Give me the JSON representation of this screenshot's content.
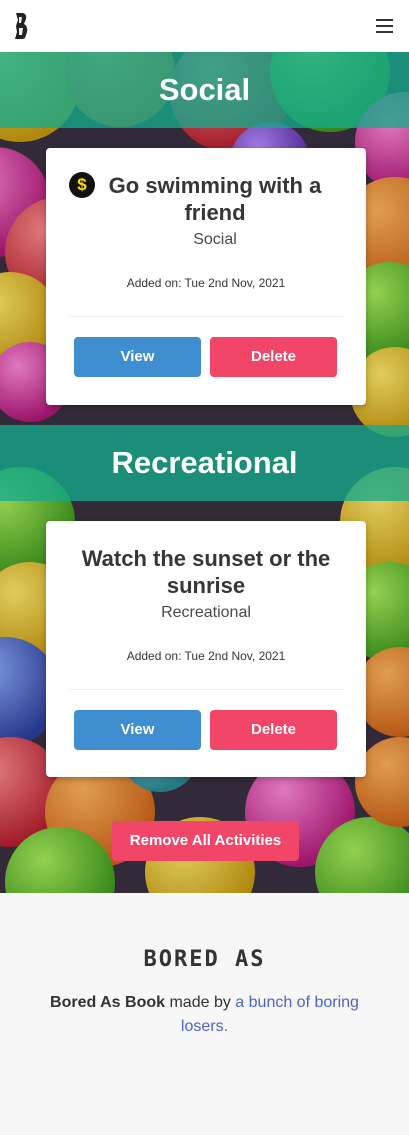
{
  "nav": {
    "logo_icon": "brand-logo-icon",
    "menu_icon": "hamburger-menu-icon"
  },
  "sections": [
    {
      "heading": "Social",
      "card": {
        "icon": "dollar-coin-icon",
        "title": "Go swimming with a friend",
        "type": "Social",
        "date": "Added on: Tue 2nd Nov, 2021",
        "view_label": "View",
        "delete_label": "Delete"
      }
    },
    {
      "heading": "Recreational",
      "card": {
        "title": "Watch the sunset or the sunrise",
        "type": "Recreational",
        "date": "Added on: Tue 2nd Nov, 2021",
        "view_label": "View",
        "delete_label": "Delete"
      }
    }
  ],
  "remove_all_label": "Remove All Activities",
  "footer": {
    "brand": "BORED AS",
    "text_prefix": "Bored As Book",
    "text_middle": " made by ",
    "link_text": "a bunch of boring losers",
    "text_suffix": "."
  },
  "colors": {
    "band": "#14aa8c",
    "view_button": "#3e8ed0",
    "delete_button": "#f14668",
    "link": "#4d64c8"
  }
}
